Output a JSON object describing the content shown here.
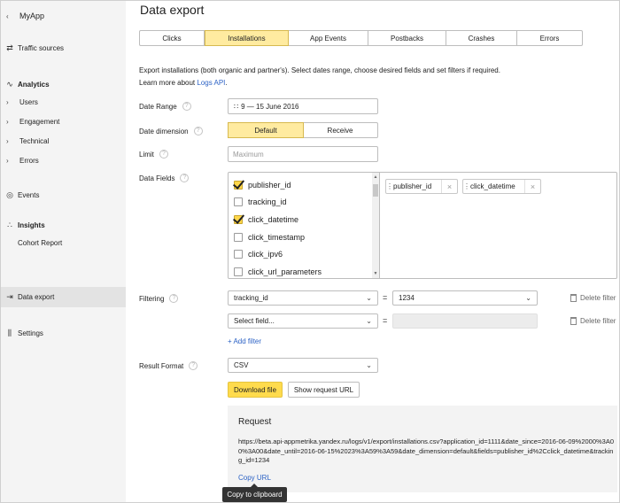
{
  "sidebar": {
    "app_name": "MyApp",
    "traffic_sources": "Traffic sources",
    "analytics": "Analytics",
    "users": "Users",
    "engagement": "Engagement",
    "technical": "Technical",
    "errors": "Errors",
    "events": "Events",
    "insights": "Insights",
    "cohort_report": "Cohort Report",
    "data_export": "Data export",
    "settings": "Settings"
  },
  "page_title": "Data export",
  "tabs": [
    "Clicks",
    "Installations",
    "App Events",
    "Postbacks",
    "Crashes",
    "Errors"
  ],
  "active_tab": "Installations",
  "intro": {
    "line1": "Export installations (both organic and partner's). Select dates range, choose desired fields and set filters if required.",
    "line2_prefix": "Learn more about ",
    "link": "Logs API",
    "line2_suffix": "."
  },
  "form": {
    "date_range_label": "Date Range",
    "date_range_value": "9 — 15 June 2016",
    "date_dimension_label": "Date dimension",
    "date_dimension_options": [
      "Default",
      "Receive"
    ],
    "limit_label": "Limit",
    "limit_placeholder": "Maximum",
    "data_fields_label": "Data Fields",
    "field_options": [
      {
        "name": "publisher_id",
        "checked": true
      },
      {
        "name": "tracking_id",
        "checked": false
      },
      {
        "name": "click_datetime",
        "checked": true
      },
      {
        "name": "click_timestamp",
        "checked": false
      },
      {
        "name": "click_ipv6",
        "checked": false
      },
      {
        "name": "click_url_parameters",
        "checked": false
      }
    ],
    "selected_fields": [
      "publisher_id",
      "click_datetime"
    ],
    "filtering_label": "Filtering",
    "filters": [
      {
        "field": "tracking_id",
        "operator": "=",
        "value": "1234",
        "delete": "Delete filter"
      },
      {
        "field": "Select field...",
        "operator": "=",
        "value": "",
        "delete": "Delete filter"
      }
    ],
    "add_filter": "+ Add filter",
    "result_format_label": "Result Format",
    "result_format_value": "CSV",
    "download_button": "Download file",
    "show_url_button": "Show request URL"
  },
  "request": {
    "heading": "Request",
    "url": "https://beta.api-appmetrika.yandex.ru/logs/v1/export/installations.csv?application_id=1111&date_since=2016-06-09%2000%3A00%3A00&date_until=2016-06-15%2023%3A59%3A59&date_dimension=default&fields=publisher_id%2Cclick_datetime&tracking_id=1234",
    "copy_link": "Copy URL",
    "tooltip": "Copy to clipboard"
  },
  "colors": {
    "accent": "#ffdb4d",
    "active_tab": "#ffeba0",
    "link": "#2c62c5",
    "sidebar_bg": "#f4f4f4"
  }
}
